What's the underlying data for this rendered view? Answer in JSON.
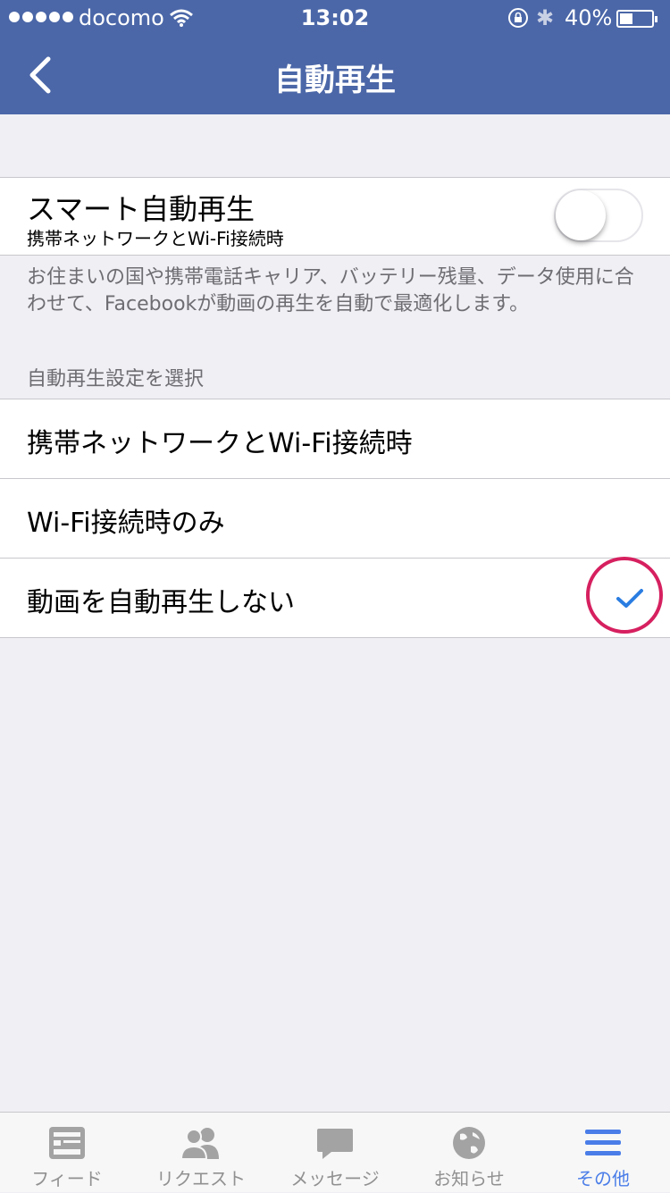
{
  "status_bar": {
    "carrier": "docomo",
    "time": "13:02",
    "battery_percent": "40%",
    "battery_level": 0.4,
    "icons": [
      "signal-dots",
      "wifi-icon",
      "rotation-lock-icon",
      "bluetooth-icon",
      "battery-icon"
    ]
  },
  "nav": {
    "title": "自動再生",
    "back_icon": "chevron-left-icon"
  },
  "smart_autoplay": {
    "title": "スマート自動再生",
    "subtitle": "携帯ネットワークとWi-Fi接続時",
    "toggle_on": false
  },
  "description": "お住まいの国や携帯電話キャリア、バッテリー残量、データ使用に合わせて、Facebookが動画の再生を自動で最適化します。",
  "section_header": "自動再生設定を選択",
  "options": [
    {
      "label": "携帯ネットワークとWi-Fi接続時",
      "selected": false
    },
    {
      "label": "Wi-Fi接続時のみ",
      "selected": false
    },
    {
      "label": "動画を自動再生しない",
      "selected": true
    }
  ],
  "tab_bar": {
    "tabs": [
      {
        "label": "フィード",
        "icon": "feed-icon",
        "active": false
      },
      {
        "label": "リクエスト",
        "icon": "friend-requests-icon",
        "active": false
      },
      {
        "label": "メッセージ",
        "icon": "messages-icon",
        "active": false
      },
      {
        "label": "お知らせ",
        "icon": "globe-icon",
        "active": false
      },
      {
        "label": "その他",
        "icon": "menu-icon",
        "active": true
      }
    ]
  },
  "colors": {
    "nav_background": "#4b67a8",
    "page_background": "#efeff4",
    "checkmark": "#2a7de1",
    "highlight_circle": "#d6205f",
    "tab_active": "#4a7de8",
    "tab_inactive": "#919191"
  }
}
